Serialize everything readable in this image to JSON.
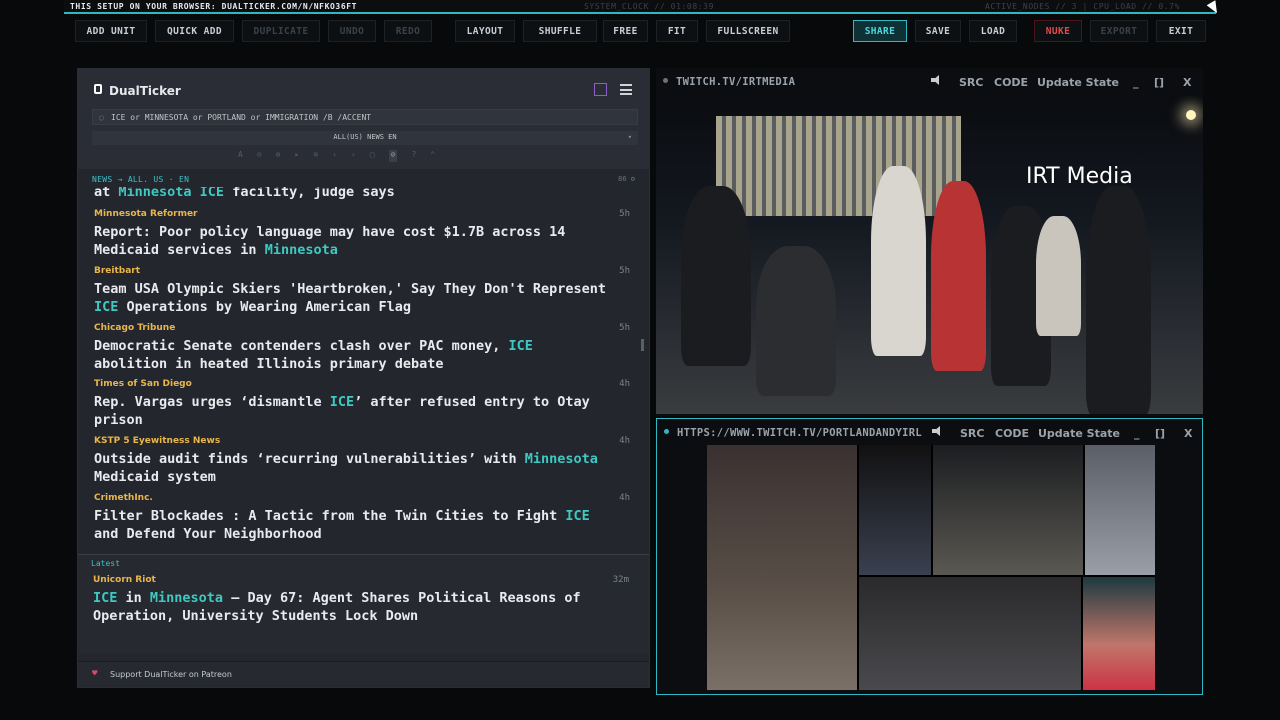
{
  "topbar": {
    "left": "THIS SETUP ON YOUR BROWSER: DUALTICKER.COM/N/NFKO36FT",
    "clock": "SYSTEM_CLOCK // 01:08:39",
    "status": "ACTIVE_NODES // 3 | CPU_LOAD // 0.7%"
  },
  "toolbar": {
    "add_unit": "ADD UNIT",
    "quick_add": "QUICK ADD",
    "duplicate": "DUPLICATE",
    "undo": "UNDO",
    "redo": "REDO",
    "layout": "LAYOUT",
    "shuffle": "SHUFFLE",
    "free": "FREE",
    "fit": "FIT",
    "fullscreen": "FULLSCREEN",
    "share": "SHARE",
    "save": "SAVE",
    "load": "LOAD",
    "nuke": "NUKE",
    "export": "EXPORT",
    "exit": "EXIT"
  },
  "ticker": {
    "name": "DualTicker",
    "query": "ICE or MINNESOTA or PORTLAND or IMMIGRATION /B /ACCENT",
    "region": "ALL(US) NEWS EN",
    "tool_icons": [
      "A",
      "⊖",
      "⊕",
      "▸",
      "≋",
      "‹",
      "›",
      "▢",
      "⊘",
      "?",
      "⌃"
    ],
    "feed_header": "NEWS → ALL. US · EN",
    "feed_count": "86",
    "partial_title": "at Minnesota ICE facility, judge says",
    "items": [
      {
        "source": "Minnesota Reformer",
        "age": "5h",
        "t1": "Report: Poor policy language may have cost $1.7B across 14",
        "t2": "Medicaid services in ",
        "h": "Minnesota",
        "t3": ""
      },
      {
        "source": "Breitbart",
        "age": "5h",
        "t1": "Team USA Olympic Skiers 'Heartbroken,' Say They Don't Represent",
        "t2": "",
        "h": "ICE",
        "t3": " Operations by Wearing American Flag"
      },
      {
        "source": "Chicago Tribune",
        "age": "5h",
        "t1": "Democratic Senate contenders clash over PAC money, ",
        "h1": "ICE",
        "t2": "abolition in heated Illinois primary debate"
      },
      {
        "source": "Times of San Diego",
        "age": "4h",
        "t1": "Rep. Vargas urges ‘dismantle ",
        "h1": "ICE",
        "t1b": "’ after refused entry to Otay",
        "t2": "prison"
      },
      {
        "source": "KSTP 5 Eyewitness News",
        "age": "4h",
        "t1": "Outside audit finds ‘recurring vulnerabilities’ with ",
        "h1": "Minnesota",
        "t2": "Medicaid system"
      },
      {
        "source": "CrimethInc.",
        "age": "4h",
        "t1": "Filter Blockades : A Tactic from the Twin Cities to Fight ",
        "h1": "ICE",
        "t2": "and Defend Your Neighborhood"
      }
    ],
    "latest_label": "Latest",
    "latest": {
      "source": "Unicorn Riot",
      "age": "32m",
      "h1": "ICE",
      "t1a": " in ",
      "h2": "Minnesota",
      "t1b": " – Day 67: Agent Shares Political Reasons of",
      "t2": "Operation, University Students Lock Down"
    },
    "footer": "Support DualTicker on Patreon"
  },
  "player1": {
    "url": "TWITCH.TV/IRTMEDIA",
    "src": "SRC",
    "code": "CODE",
    "update": "Update State",
    "min": "_",
    "max": "[]",
    "close": "X",
    "watermark": "IRT Media"
  },
  "player2": {
    "url": "HTTPS://WWW.TWITCH.TV/PORTLANDANDYIRL",
    "src": "SRC",
    "code": "CODE",
    "update": "Update State",
    "min": "_",
    "max": "[]",
    "close": "X"
  },
  "colors": {
    "accent": "#2fb8c4",
    "highlight": "#3ec9c2",
    "source": "#e9b64a",
    "nuke": "#e24a4a"
  }
}
